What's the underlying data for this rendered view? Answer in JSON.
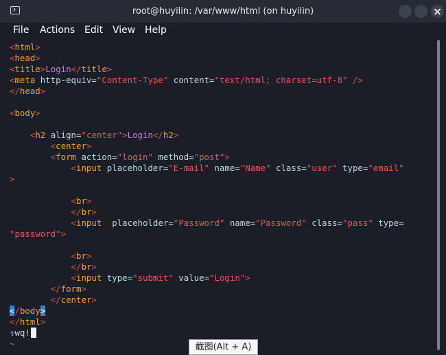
{
  "window": {
    "title": "root@huyilin: /var/www/html (on huyilin)",
    "icon": "terminal-icon",
    "controls": [
      "minimize",
      "maximize",
      "close-icon"
    ]
  },
  "menu": [
    "File",
    "Actions",
    "Edit",
    "View",
    "Help"
  ],
  "editor": {
    "lines": [
      [
        [
          "br",
          "<"
        ],
        [
          "tag",
          "html"
        ],
        [
          "br",
          ">"
        ]
      ],
      [
        [
          "br",
          "<"
        ],
        [
          "tag",
          "head"
        ],
        [
          "br",
          ">"
        ]
      ],
      [
        [
          "br",
          "<"
        ],
        [
          "tag",
          "title"
        ],
        [
          "br",
          ">"
        ],
        [
          "tx",
          "Login"
        ],
        [
          "br",
          "</"
        ],
        [
          "tag",
          "title"
        ],
        [
          "br",
          ">"
        ]
      ],
      [
        [
          "br",
          "<"
        ],
        [
          "tag",
          "meta"
        ],
        [
          "plain",
          " "
        ],
        [
          "at",
          "http-equiv"
        ],
        [
          "plain",
          "="
        ],
        [
          "sv",
          "\"Content-Type\""
        ],
        [
          "plain",
          " "
        ],
        [
          "at",
          "content"
        ],
        [
          "plain",
          "="
        ],
        [
          "sv",
          "\"text/html; charset=utf-8\""
        ],
        [
          "plain",
          " "
        ],
        [
          "br",
          "/>"
        ]
      ],
      [
        [
          "br",
          "</"
        ],
        [
          "tag",
          "head"
        ],
        [
          "br",
          ">"
        ]
      ],
      [],
      [
        [
          "br",
          "<"
        ],
        [
          "tag",
          "body"
        ],
        [
          "br",
          ">"
        ]
      ],
      [],
      [
        [
          "plain",
          "    "
        ],
        [
          "br",
          "<"
        ],
        [
          "tag",
          "h2"
        ],
        [
          "plain",
          " "
        ],
        [
          "at",
          "align"
        ],
        [
          "plain",
          "="
        ],
        [
          "sv",
          "\"center\""
        ],
        [
          "br",
          ">"
        ],
        [
          "tx",
          "Login"
        ],
        [
          "br",
          "</"
        ],
        [
          "tag",
          "h2"
        ],
        [
          "br",
          ">"
        ]
      ],
      [
        [
          "plain",
          "        "
        ],
        [
          "br",
          "<"
        ],
        [
          "tag",
          "center"
        ],
        [
          "br",
          ">"
        ]
      ],
      [
        [
          "plain",
          "        "
        ],
        [
          "br",
          "<"
        ],
        [
          "tag",
          "form"
        ],
        [
          "plain",
          " "
        ],
        [
          "at",
          "action"
        ],
        [
          "plain",
          "="
        ],
        [
          "sv",
          "\"login\""
        ],
        [
          "plain",
          " "
        ],
        [
          "at",
          "method"
        ],
        [
          "plain",
          "="
        ],
        [
          "sv",
          "\"post\""
        ],
        [
          "br",
          ">"
        ]
      ],
      [
        [
          "plain",
          "            "
        ],
        [
          "br",
          "<"
        ],
        [
          "tag",
          "input"
        ],
        [
          "plain",
          " "
        ],
        [
          "at",
          "placeholder"
        ],
        [
          "plain",
          "="
        ],
        [
          "sv",
          "\"E-mail\""
        ],
        [
          "plain",
          " "
        ],
        [
          "at",
          "name"
        ],
        [
          "plain",
          "="
        ],
        [
          "sv",
          "\"Name\""
        ],
        [
          "plain",
          " "
        ],
        [
          "at",
          "class"
        ],
        [
          "plain",
          "="
        ],
        [
          "sv",
          "\"user\""
        ],
        [
          "plain",
          " "
        ],
        [
          "at",
          "type"
        ],
        [
          "plain",
          "="
        ],
        [
          "sv",
          "\"email\""
        ]
      ],
      [
        [
          "br",
          ">"
        ]
      ],
      [],
      [
        [
          "plain",
          "            "
        ],
        [
          "br",
          "<"
        ],
        [
          "tag",
          "br"
        ],
        [
          "br",
          ">"
        ]
      ],
      [
        [
          "plain",
          "            "
        ],
        [
          "br",
          "</"
        ],
        [
          "tag",
          "br"
        ],
        [
          "br",
          ">"
        ]
      ],
      [
        [
          "plain",
          "            "
        ],
        [
          "br",
          "<"
        ],
        [
          "tag",
          "input"
        ],
        [
          "plain",
          "  "
        ],
        [
          "at",
          "placeholder"
        ],
        [
          "plain",
          "="
        ],
        [
          "sv",
          "\"Password\""
        ],
        [
          "plain",
          " "
        ],
        [
          "at",
          "name"
        ],
        [
          "plain",
          "="
        ],
        [
          "sv",
          "\"Password\""
        ],
        [
          "plain",
          " "
        ],
        [
          "at",
          "class"
        ],
        [
          "plain",
          "="
        ],
        [
          "sv",
          "\"pass\""
        ],
        [
          "plain",
          " "
        ],
        [
          "at",
          "type"
        ],
        [
          "plain",
          "="
        ]
      ],
      [
        [
          "sv",
          "\"password\""
        ],
        [
          "br",
          ">"
        ]
      ],
      [],
      [
        [
          "plain",
          "            "
        ],
        [
          "br",
          "<"
        ],
        [
          "tag",
          "br"
        ],
        [
          "br",
          ">"
        ]
      ],
      [
        [
          "plain",
          "            "
        ],
        [
          "br",
          "</"
        ],
        [
          "tag",
          "br"
        ],
        [
          "br",
          ">"
        ]
      ],
      [
        [
          "plain",
          "            "
        ],
        [
          "br",
          "<"
        ],
        [
          "tag",
          "input"
        ],
        [
          "plain",
          " "
        ],
        [
          "at",
          "type"
        ],
        [
          "plain",
          "="
        ],
        [
          "sv",
          "\"submit\""
        ],
        [
          "plain",
          " "
        ],
        [
          "at",
          "value"
        ],
        [
          "plain",
          "="
        ],
        [
          "sv",
          "\"Login\""
        ],
        [
          "br",
          ">"
        ]
      ],
      [
        [
          "plain",
          "        "
        ],
        [
          "br",
          "</"
        ],
        [
          "tag",
          "form"
        ],
        [
          "br",
          ">"
        ]
      ],
      [
        [
          "plain",
          "        "
        ],
        [
          "br",
          "</"
        ],
        [
          "tag",
          "center"
        ],
        [
          "br",
          ">"
        ]
      ],
      [
        [
          "hl",
          "<"
        ],
        [
          "br",
          "/"
        ],
        [
          "tag",
          "body"
        ],
        [
          "hl",
          ">"
        ]
      ],
      [
        [
          "br",
          "</"
        ],
        [
          "tag",
          "html"
        ],
        [
          "br",
          ">"
        ]
      ],
      [
        [
          "tilde",
          "~"
        ]
      ],
      [
        [
          "tilde",
          "~"
        ]
      ]
    ],
    "command": ":wq!"
  },
  "tooltip": "截图(Alt + A)"
}
